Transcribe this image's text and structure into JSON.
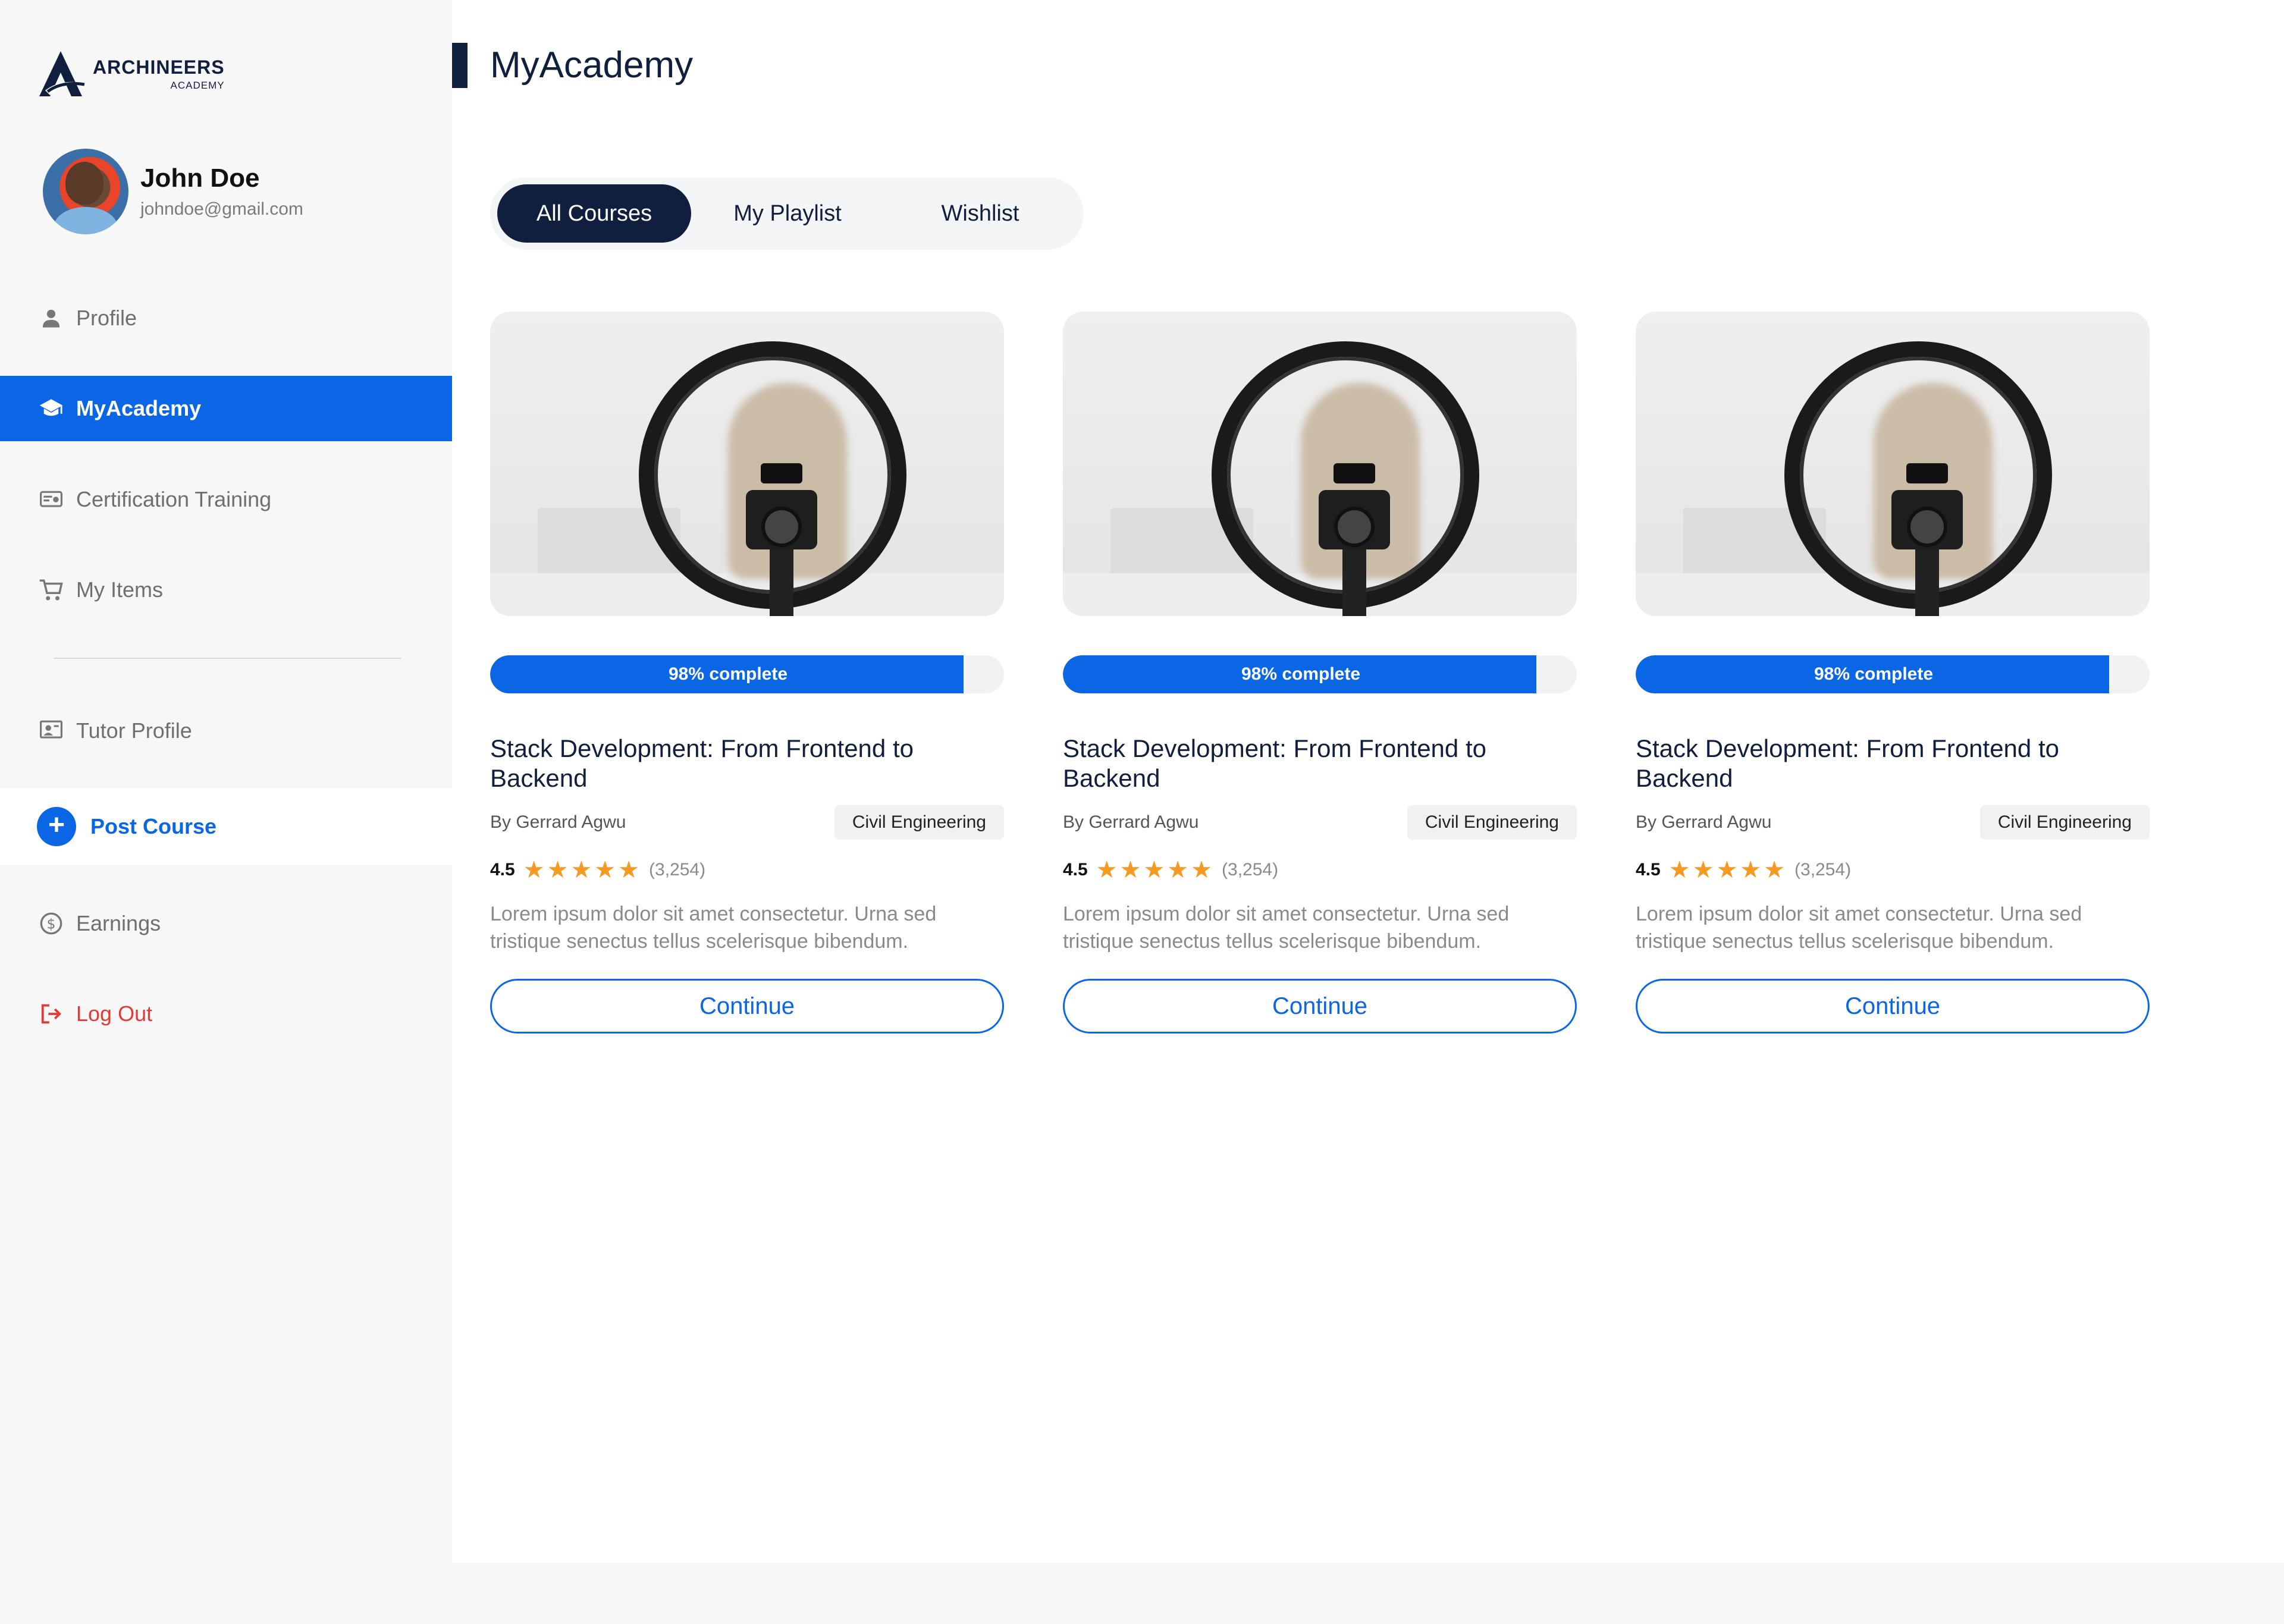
{
  "brand": {
    "name": "ARCHINEERS",
    "sub": "ACADEMY",
    "color": "#0f1f3d"
  },
  "user": {
    "name": "John Doe",
    "email": "johndoe@gmail.com"
  },
  "sidebar": {
    "items": [
      {
        "label": "Profile",
        "icon": "person-icon"
      },
      {
        "label": "MyAcademy",
        "icon": "graduation-cap-icon",
        "active": true
      },
      {
        "label": "Certification Training",
        "icon": "certificate-icon"
      },
      {
        "label": "My Items",
        "icon": "cart-icon"
      },
      {
        "label": "Tutor Profile",
        "icon": "tutor-board-icon"
      },
      {
        "label": "Post Course",
        "icon": "plus-circle-icon"
      },
      {
        "label": "Earnings",
        "icon": "dollar-circle-icon"
      },
      {
        "label": "Log Out",
        "icon": "logout-icon"
      }
    ]
  },
  "page": {
    "title": "MyAcademy"
  },
  "tabs": [
    {
      "label": "All Courses",
      "active": true
    },
    {
      "label": "My Playlist"
    },
    {
      "label": "Wishlist"
    }
  ],
  "courses": [
    {
      "progress_pct": 98,
      "progress_label": "98% complete",
      "title": "Stack Development: From Frontend to Backend",
      "author": "By Gerrard Agwu",
      "category": "Civil Engineering",
      "rating": "4.5",
      "reviews": "(3,254)",
      "description": "Lorem ipsum dolor sit amet consectetur. Urna sed tristique senectus tellus scelerisque bibendum.",
      "cta": "Continue"
    },
    {
      "progress_pct": 98,
      "progress_label": "98% complete",
      "title": "Stack Development: From Frontend to Backend",
      "author": "By Gerrard Agwu",
      "category": "Civil Engineering",
      "rating": "4.5",
      "reviews": "(3,254)",
      "description": "Lorem ipsum dolor sit amet consectetur. Urna sed tristique senectus tellus scelerisque bibendum.",
      "cta": "Continue"
    },
    {
      "progress_pct": 98,
      "progress_label": "98% complete",
      "title": "Stack Development: From Frontend to Backend",
      "author": "By Gerrard Agwu",
      "category": "Civil Engineering",
      "rating": "4.5",
      "reviews": "(3,254)",
      "description": "Lorem ipsum dolor sit amet consectetur. Urna sed tristique senectus tellus scelerisque bibendum.",
      "cta": "Continue"
    }
  ],
  "colors": {
    "accent": "#0a66e4",
    "navy": "#0f1f3d",
    "star": "#f59a23",
    "logout": "#e53935"
  }
}
